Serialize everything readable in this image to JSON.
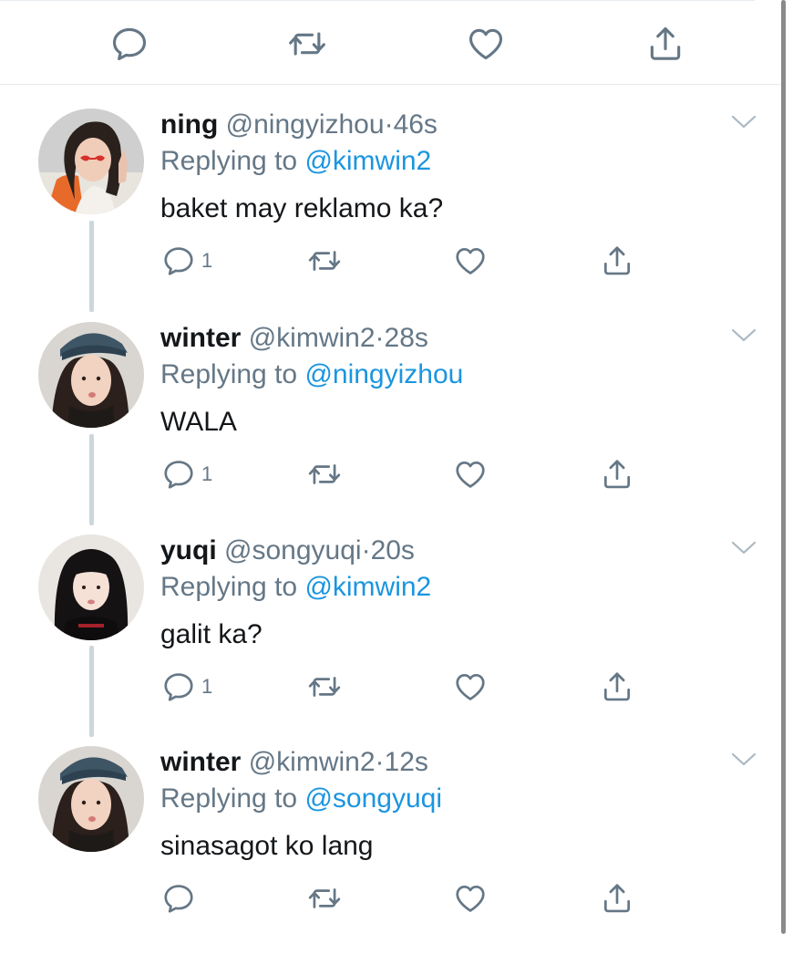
{
  "colors": {
    "accent_blue": "#1b95e0",
    "secondary_text": "#657786",
    "primary_text": "#14171a",
    "icon_gray": "#657786",
    "thread_line": "#ccd6dd"
  },
  "icons": {
    "reply": "reply-icon",
    "retweet": "retweet-icon",
    "like": "like-icon",
    "share": "share-icon",
    "more": "chevron-down-icon"
  },
  "tweets": [
    {
      "name": "ning",
      "handle": "@ningyizhou",
      "separator": "·",
      "time": "46s",
      "replying_prefix": "Replying to",
      "replying_to": "@kimwin2",
      "text": "baket may reklamo ka?",
      "reply_count": "1"
    },
    {
      "name": "winter",
      "handle": "@kimwin2",
      "separator": "·",
      "time": "28s",
      "replying_prefix": "Replying to",
      "replying_to": "@ningyizhou",
      "text": "WALA",
      "reply_count": "1"
    },
    {
      "name": "yuqi",
      "handle": "@songyuqi",
      "separator": "·",
      "time": "20s",
      "replying_prefix": "Replying to",
      "replying_to": "@kimwin2",
      "text": "galit ka?",
      "reply_count": "1"
    },
    {
      "name": "winter",
      "handle": "@kimwin2",
      "separator": "·",
      "time": "12s",
      "replying_prefix": "Replying to",
      "replying_to": "@songyuqi",
      "text": "sinasagot ko lang",
      "reply_count": ""
    }
  ]
}
